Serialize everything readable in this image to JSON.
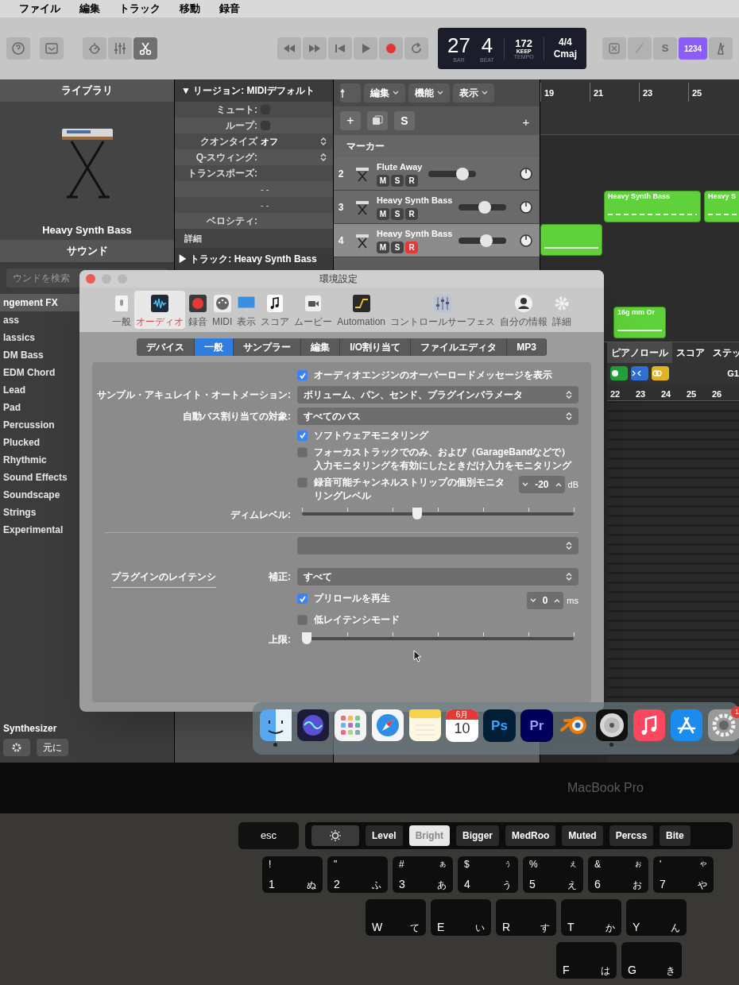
{
  "menu_bar": {
    "items": [
      "ファイル",
      "編集",
      "トラック",
      "移動",
      "録音"
    ]
  },
  "toolbar": {
    "lcd": {
      "bar": "27",
      "beat": "4",
      "bar_label": "BAR",
      "beat_label": "BEAT",
      "tempo": "172",
      "tempo_mode": "KEEP",
      "tempo_label": "TEMPO",
      "signature": "4/4",
      "key": "Cmaj"
    },
    "s_button": "S",
    "count_in": "1234"
  },
  "library": {
    "title": "ライブラリ",
    "patch": "Heavy Synth Bass",
    "sound_title": "サウンド",
    "search": {
      "placeholder": "ウンドを検索"
    },
    "categories": [
      {
        "label": "ngement FX",
        "selected": true
      },
      {
        "label": "ass",
        "selected": false
      },
      {
        "label": "lassics",
        "selected": false
      },
      {
        "label": "DM Bass",
        "selected": false
      },
      {
        "label": "EDM Chord",
        "selected": false
      },
      {
        "label": "Lead",
        "selected": false
      },
      {
        "label": "Pad",
        "selected": false
      },
      {
        "label": "Percussion",
        "selected": false
      },
      {
        "label": "Plucked",
        "selected": false
      },
      {
        "label": "Rhythmic",
        "selected": false
      },
      {
        "label": "Sound Effects",
        "selected": false
      },
      {
        "label": "Soundscape",
        "selected": false
      },
      {
        "label": "Strings",
        "selected": false
      },
      {
        "label": "Experimental",
        "selected": false
      }
    ],
    "footer": "Synthesizer",
    "revert_button": "元に"
  },
  "inspector": {
    "region_title": "▼ リージョン: MIDIデフォルト",
    "rows": [
      {
        "kind": "checkbox",
        "label": "ミュート:",
        "checked": false
      },
      {
        "kind": "checkbox",
        "label": "ループ:",
        "checked": false
      },
      {
        "kind": "select",
        "label": "クオンタイズ",
        "value": "オフ"
      },
      {
        "kind": "select",
        "label": "Q-スウィング:"
      },
      {
        "kind": "text",
        "label": "トランスポーズ:"
      },
      {
        "kind": "text",
        "value": "- -"
      },
      {
        "kind": "text",
        "value": "- -"
      },
      {
        "kind": "text",
        "label": "ベロシティ:"
      }
    ],
    "details": "詳細",
    "track_title": "▶ トラック: Heavy Synth Bass"
  },
  "tracks": {
    "menus": [
      "編集",
      "機能",
      "表示"
    ],
    "add_button": "+",
    "s_button": "S",
    "add_right": "+",
    "marker_label": "マーカー",
    "rows": [
      {
        "number": "2",
        "name": "Flute Away",
        "mute": "M",
        "solo": "S",
        "record": "R",
        "armed": false,
        "selected": false,
        "level": 0.78
      },
      {
        "number": "3",
        "name": "Heavy Synth Bass",
        "mute": "M",
        "solo": "S",
        "record": "R",
        "armed": false,
        "selected": false,
        "level": 0.55
      },
      {
        "number": "4",
        "name": "Heavy Synth Bass",
        "mute": "M",
        "solo": "S",
        "record": "R",
        "armed": true,
        "selected": true,
        "level": 0.6
      }
    ]
  },
  "timeline": {
    "ruler": [
      "19",
      "21",
      "23",
      "25"
    ],
    "regions": [
      {
        "kind": "notes",
        "name": "Heavy Synth Bass"
      },
      {
        "kind": "notes",
        "name": "Heavy S"
      },
      {
        "kind": "line"
      },
      {
        "kind": "line",
        "name": "16g mm Or"
      }
    ]
  },
  "editor": {
    "tabs": [
      {
        "label": "ピアノロール",
        "selected": true
      },
      {
        "label": "スコア",
        "selected": false
      },
      {
        "label": "ステッ",
        "selected": false
      }
    ],
    "pitch": "G1",
    "ruler": [
      "22",
      "23",
      "24",
      "25",
      "26"
    ]
  },
  "preferences": {
    "title": "環境設定",
    "categories": [
      {
        "kind": "general",
        "label": "一般",
        "selected": false
      },
      {
        "kind": "audio",
        "label": "オーディオ",
        "selected": true
      },
      {
        "kind": "record",
        "label": "録音",
        "selected": false
      },
      {
        "kind": "midi",
        "label": "MIDI",
        "selected": false
      },
      {
        "kind": "display",
        "label": "表示",
        "selected": false
      },
      {
        "kind": "score",
        "label": "スコア",
        "selected": false
      },
      {
        "kind": "movie",
        "label": "ムービー",
        "selected": false
      },
      {
        "kind": "automation",
        "label": "Automation",
        "selected": false
      },
      {
        "kind": "control",
        "label": "コントロールサーフェス",
        "selected": false
      },
      {
        "kind": "account",
        "label": "自分の情報",
        "selected": false
      },
      {
        "kind": "advanced",
        "label": "詳細",
        "selected": false
      }
    ],
    "tabs": [
      {
        "label": "デバイス",
        "selected": false
      },
      {
        "label": "一般",
        "selected": true
      },
      {
        "label": "サンプラー",
        "selected": false
      },
      {
        "label": "編集",
        "selected": false
      },
      {
        "label": "I/O割り当て",
        "selected": false
      },
      {
        "label": "ファイルエディタ",
        "selected": false
      },
      {
        "label": "MP3",
        "selected": false
      }
    ],
    "overload_message": {
      "label": "オーディオエンジンのオーバーロードメッセージを表示",
      "checked": true
    },
    "automation": {
      "label": "サンプル・アキュレイト・オートメーション:",
      "value": "ボリューム、パン、センド、プラグインパラメータ"
    },
    "bus": {
      "label": "自動バス割り当ての対象:",
      "value": "すべてのバス"
    },
    "software_monitoring": {
      "label": "ソフトウェアモニタリング",
      "checked": true
    },
    "focus_monitoring": {
      "label": "フォーカストラックでのみ、および（GarageBandなどで）入力モニタリングを有効にしたときだけ入力をモニタリング",
      "checked": false
    },
    "individual_level": {
      "label": "録音可能チャンネルストリップの個別モニタリングレベル",
      "checked": false
    },
    "monitor_level": {
      "value": "-20",
      "unit": "dB"
    },
    "dim_level": {
      "label": "ディムレベル:",
      "level": 0.42
    },
    "latency": {
      "title": "プラグインのレイテンシ",
      "compensation_label": "補正:",
      "compensation": "すべて",
      "preroll": {
        "label": "プリロールを再生",
        "checked": true
      },
      "low_latency": {
        "label": "低レイテンシモード",
        "checked": false
      },
      "limit_value": {
        "value": "0",
        "unit": "ms"
      },
      "limit": {
        "label": "上限:",
        "level": 0
      }
    }
  },
  "dock": [
    {
      "kind": "finder",
      "running": true
    },
    {
      "kind": "siri",
      "running": false
    },
    {
      "kind": "launchpad",
      "running": false
    },
    {
      "kind": "safari",
      "running": false
    },
    {
      "kind": "notes",
      "running": false
    },
    {
      "kind": "calendar",
      "month": "6月",
      "day": "10",
      "running": false
    },
    {
      "kind": "photoshop",
      "label": "Ps",
      "running": false
    },
    {
      "kind": "premiere",
      "label": "Pr",
      "running": false
    },
    {
      "kind": "blender",
      "running": false
    },
    {
      "kind": "logic",
      "running": true
    },
    {
      "kind": "music",
      "running": false
    },
    {
      "kind": "appstore",
      "running": false
    },
    {
      "kind": "settings",
      "badge": "1",
      "running": false
    }
  ],
  "laptop": {
    "model": "MacBook Pro"
  },
  "touch_bar": {
    "esc": "esc",
    "buttons": [
      {
        "label": "Level",
        "selected": false
      },
      {
        "label": "Bright",
        "selected": true
      },
      {
        "label": "Bigger",
        "selected": false
      },
      {
        "label": "MedRoo",
        "selected": false
      },
      {
        "label": "Muted",
        "selected": false
      },
      {
        "label": "Percss",
        "selected": false
      },
      {
        "label": "Bite",
        "selected": false
      }
    ]
  },
  "keyboard": {
    "rows": [
      [
        {
          "shift": "!",
          "main": "1",
          "kana": "ぬ"
        },
        {
          "shift": "\"",
          "main": "2",
          "kana": "ふ"
        },
        {
          "shift": "#",
          "small": "ぁ",
          "main": "3",
          "kana": "あ"
        },
        {
          "shift": "$",
          "small": "ぅ",
          "main": "4",
          "kana": "う"
        },
        {
          "shift": "%",
          "small": "ぇ",
          "main": "5",
          "kana": "え"
        },
        {
          "shift": "&",
          "small": "ぉ",
          "main": "6",
          "kana": "お"
        },
        {
          "shift": "'",
          "small": "ゃ",
          "main": "7",
          "kana": "や"
        }
      ],
      [
        {
          "main": "W",
          "kana": "て"
        },
        {
          "main": "E",
          "kana": "い"
        },
        {
          "main": "R",
          "kana": "す"
        },
        {
          "main": "T",
          "kana": "か"
        },
        {
          "main": "Y",
          "kana": "ん"
        }
      ],
      [
        {
          "main": "F",
          "kana": "は"
        },
        {
          "main": "G",
          "kana": "き"
        }
      ]
    ]
  }
}
